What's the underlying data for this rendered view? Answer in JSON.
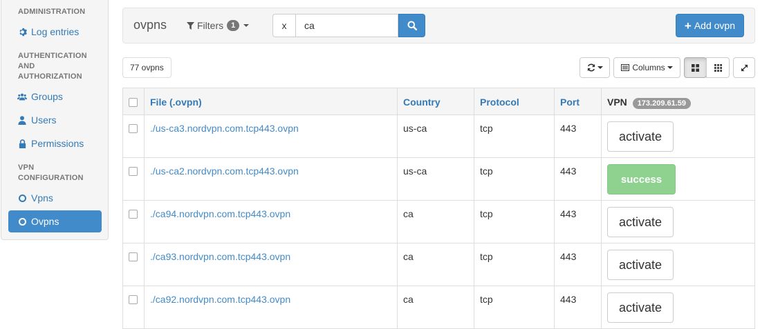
{
  "sidebar": {
    "section_admin": "ADMINISTRATION",
    "log_entries": "Log entries",
    "section_auth_1": "AUTHENTICATION",
    "section_auth_2": "AND",
    "section_auth_3": "AUTHORIZATION",
    "groups": "Groups",
    "users": "Users",
    "permissions": "Permissions",
    "section_vpn_1": "VPN",
    "section_vpn_2": "CONFIGURATION",
    "vpns": "Vpns",
    "ovpns": "Ovpns"
  },
  "toolbar": {
    "title": "ovpns",
    "filters_label": "Filters",
    "filters_count": "1",
    "search_clear": "x",
    "search_value": "ca",
    "add_label": "Add ovpn"
  },
  "list": {
    "count_label": "77 ovpns",
    "columns_label": "Columns"
  },
  "table": {
    "headers": {
      "file": "File (.ovpn)",
      "country": "Country",
      "protocol": "Protocol",
      "port": "Port",
      "vpn": "VPN",
      "vpn_ip": "173.209.61.59"
    },
    "rows": [
      {
        "file": "./us-ca3.nordvpn.com.tcp443.ovpn",
        "country": "us-ca",
        "protocol": "tcp",
        "port": "443",
        "action": "activate"
      },
      {
        "file": "./us-ca2.nordvpn.com.tcp443.ovpn",
        "country": "us-ca",
        "protocol": "tcp",
        "port": "443",
        "action": "success"
      },
      {
        "file": "./ca94.nordvpn.com.tcp443.ovpn",
        "country": "ca",
        "protocol": "tcp",
        "port": "443",
        "action": "activate"
      },
      {
        "file": "./ca93.nordvpn.com.tcp443.ovpn",
        "country": "ca",
        "protocol": "tcp",
        "port": "443",
        "action": "activate"
      },
      {
        "file": "./ca92.nordvpn.com.tcp443.ovpn",
        "country": "ca",
        "protocol": "tcp",
        "port": "443",
        "action": "activate"
      }
    ]
  },
  "colors": {
    "primary": "#428bca",
    "success": "#8fd18f",
    "link": "#337ab7"
  }
}
